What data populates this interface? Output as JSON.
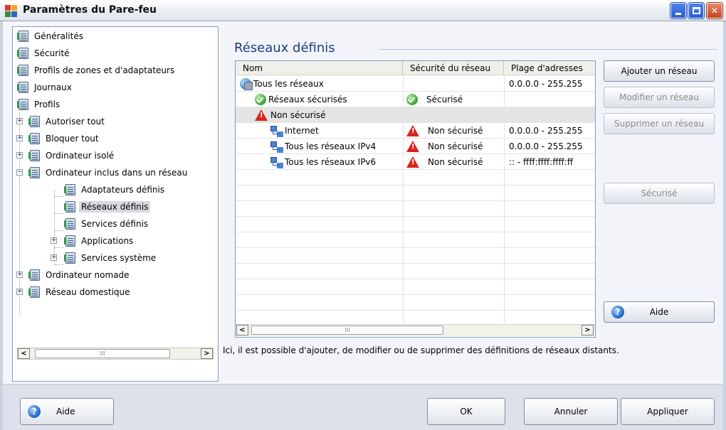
{
  "window": {
    "title": "Paramètres du Pare-feu",
    "controls": [
      "minimize",
      "maximize",
      "close"
    ]
  },
  "tree": {
    "items": [
      {
        "label": "Généralités"
      },
      {
        "label": "Sécurité"
      },
      {
        "label": "Profils de zones et d'adaptateurs"
      },
      {
        "label": "Journaux"
      },
      {
        "label": "Profils"
      },
      {
        "label": "Autoriser tout",
        "expander": "+"
      },
      {
        "label": "Bloquer tout",
        "expander": "+"
      },
      {
        "label": "Ordinateur isolé",
        "expander": "+"
      },
      {
        "label": "Ordinateur inclus dans un réseau",
        "expander": "−"
      },
      {
        "label": "Adaptateurs définis"
      },
      {
        "label": "Réseaux définis",
        "selected": true
      },
      {
        "label": "Services définis"
      },
      {
        "label": "Applications",
        "expander": "+"
      },
      {
        "label": "Services système",
        "expander": "+"
      },
      {
        "label": "Ordinateur nomade",
        "expander": "+"
      },
      {
        "label": "Réseau domestique",
        "expander": "+"
      }
    ],
    "scroll_thumb_glyph": "III"
  },
  "content": {
    "title": "Réseaux définis",
    "columns": {
      "name": "Nom",
      "security": "Sécurité du réseau",
      "range": "Plage d'adresses"
    },
    "rows": [
      {
        "name": "Tous les réseaux",
        "icon": "globe-icon",
        "security": "",
        "security_icon": "",
        "range": "0.0.0.0 - 255.255"
      },
      {
        "name": "Réseaux sécurisés",
        "icon": "check-icon",
        "security": "Sécurisé",
        "security_icon": "check-icon",
        "range": ""
      },
      {
        "name": "Non sécurisé",
        "icon": "warning-icon",
        "security": "",
        "security_icon": "",
        "range": ""
      },
      {
        "name": "Internet",
        "icon": "network-icon",
        "security": "Non sécurisé",
        "security_icon": "warning-icon",
        "range": "0.0.0.0 - 255.255"
      },
      {
        "name": "Tous les réseaux IPv4",
        "icon": "network-icon",
        "security": "Non sécurisé",
        "security_icon": "warning-icon",
        "range": "0.0.0.0 - 255.255"
      },
      {
        "name": "Tous les réseaux IPv6",
        "icon": "network-icon",
        "security": "Non sécurisé",
        "security_icon": "warning-icon",
        "range": ":: - ffff:ffff:ffff:ff"
      }
    ],
    "scroll_thumb_glyph": "III",
    "description": "Ici, il est possible d'ajouter, de modifier ou de supprimer des définitions de réseaux distants."
  },
  "side_buttons": {
    "add": "Ajouter un réseau",
    "edit": "Modifier un réseau",
    "delete": "Supprimer un réseau",
    "secured": "Sécurisé",
    "help": "Aide"
  },
  "bottom_buttons": {
    "help": "Aide",
    "ok": "OK",
    "cancel": "Annuler",
    "apply": "Appliquer"
  },
  "colors": {
    "title_accent": "#1d3a8a",
    "selection": "#d8d8de",
    "warning": "#d8281e",
    "secure": "#3aa03a"
  }
}
